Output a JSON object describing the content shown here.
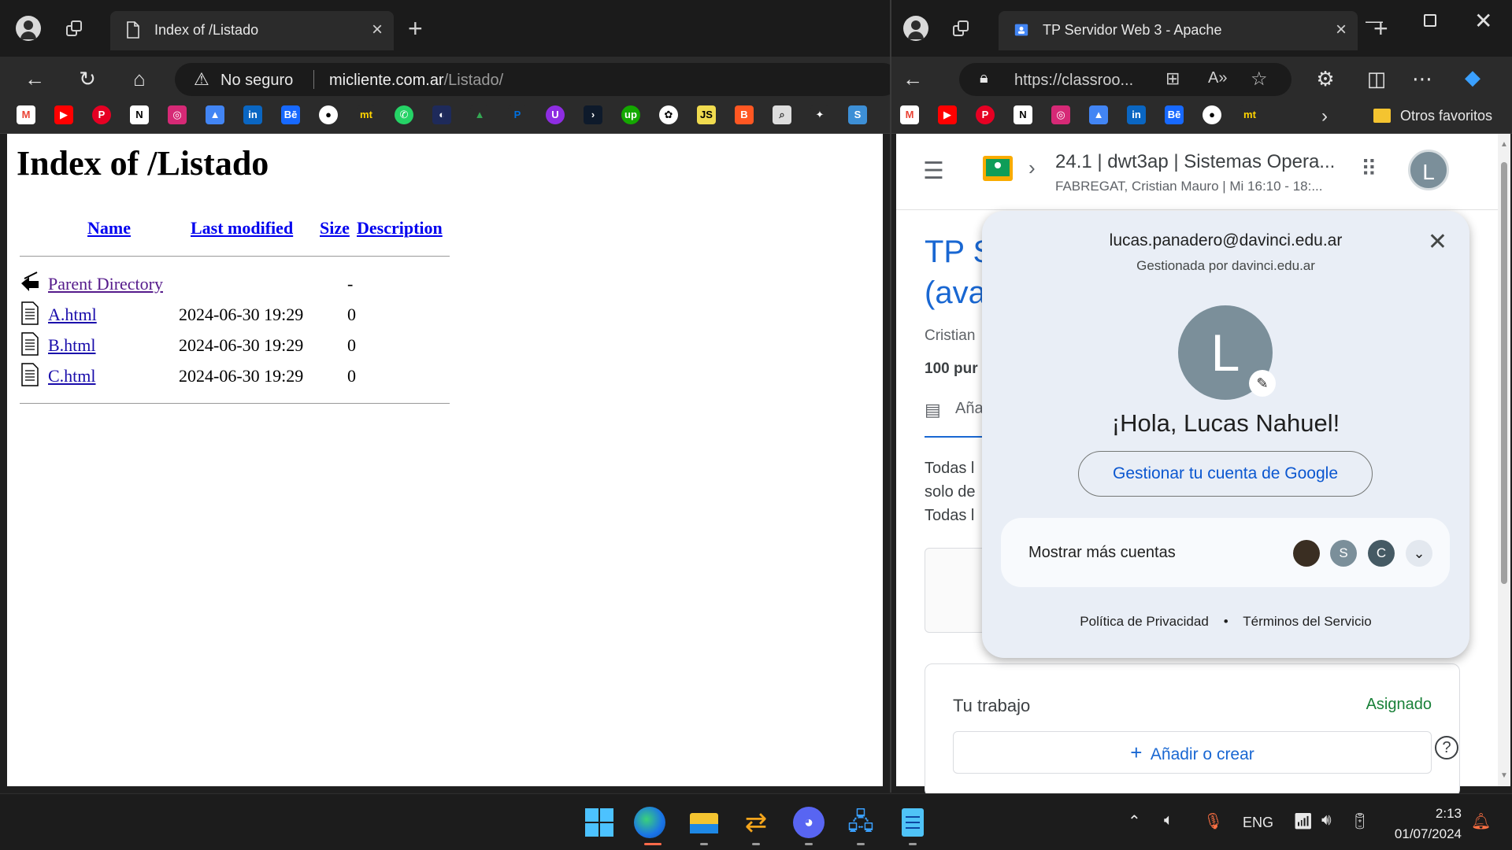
{
  "left_browser": {
    "tab_title": "Index of /Listado",
    "security_label": "No seguro",
    "url_host": "micliente.com.ar",
    "url_path": "/Listado/"
  },
  "right_browser": {
    "tab_title": "TP Servidor Web 3 - Apache",
    "url": "https://classroo...",
    "bookmarks_other": "Otros favoritos"
  },
  "listing": {
    "heading": "Index of /Listado",
    "columns": {
      "name": "Name",
      "modified": "Last modified",
      "size": "Size",
      "description": "Description"
    },
    "rows": [
      {
        "name": "Parent Directory",
        "modified": "",
        "size": "-",
        "icon": "back-icon"
      },
      {
        "name": "A.html",
        "modified": "2024-06-30 19:29",
        "size": "0",
        "icon": "file-icon"
      },
      {
        "name": "B.html",
        "modified": "2024-06-30 19:29",
        "size": "0",
        "icon": "file-icon"
      },
      {
        "name": "C.html",
        "modified": "2024-06-30 19:29",
        "size": "0",
        "icon": "file-icon"
      }
    ]
  },
  "classroom": {
    "course_title": "24.1 | dwt3ap | Sistemas Opera...",
    "course_subtitle": "FABREGAT, Cristian Mauro | Mi 16:10 - 18:...",
    "avatar_letter": "L",
    "assign_title_1": "TP S",
    "assign_title_2": "(ava",
    "author": "Cristian",
    "points": "100 pur",
    "comments_label": "Aña",
    "body_line1": "Todas l",
    "body_line2": "solo de",
    "body_line3": "Todas l",
    "your_work": "Tu trabajo",
    "status": "Asignado",
    "add_create": "Añadir o crear",
    "help": "?"
  },
  "account_popup": {
    "email": "lucas.panadero@davinci.edu.ar",
    "managed_by": "Gestionada por davinci.edu.ar",
    "avatar_letter": "L",
    "greeting": "¡Hola, Lucas Nahuel!",
    "manage_button": "Gestionar tu cuenta de Google",
    "more_accounts": "Mostrar más cuentas",
    "account_letters": [
      "S",
      "C"
    ],
    "privacy": "Política de Privacidad",
    "dot": "•",
    "terms": "Términos del Servicio"
  },
  "taskbar": {
    "language": "ENG",
    "time": "2:13",
    "date": "01/07/2024"
  },
  "colors": {
    "classroom_blue": "#1967d2",
    "classroom_green": "#188038",
    "popup_bg": "#e9eef6",
    "link_blue": "#0b57d0"
  }
}
